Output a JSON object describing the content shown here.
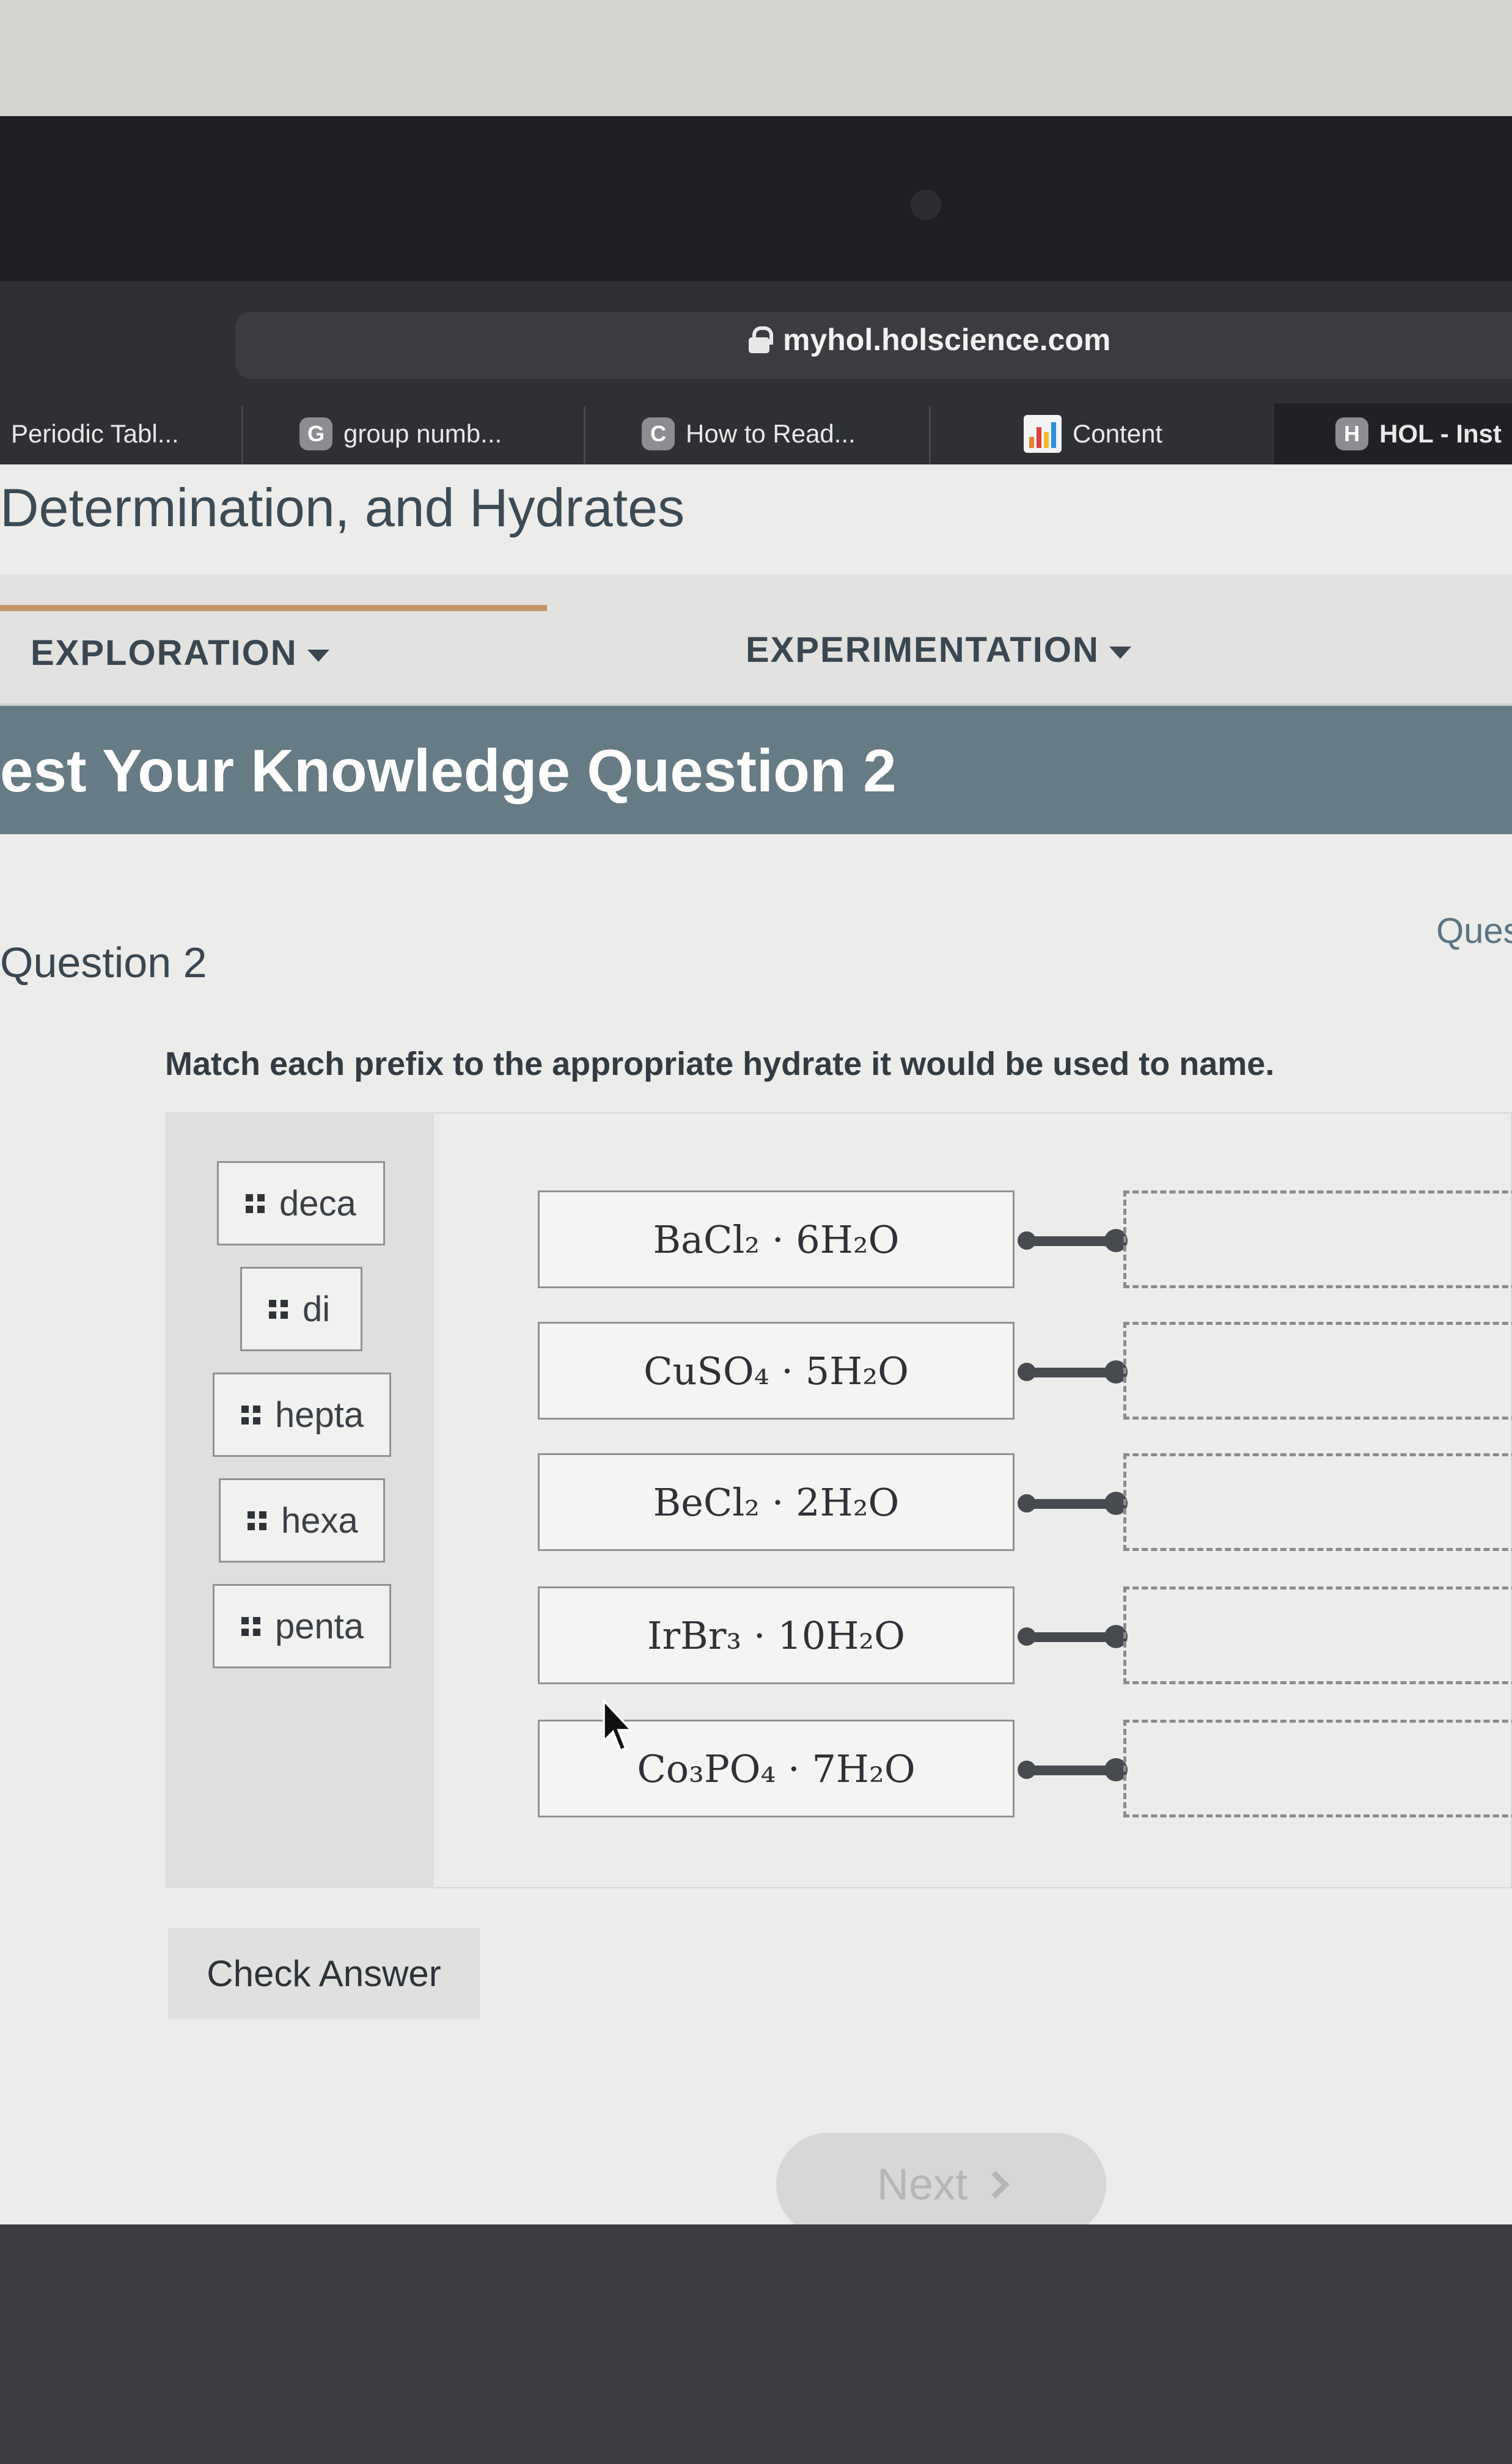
{
  "browser": {
    "url": "myhol.holscience.com",
    "tabs": [
      {
        "label": "Periodic Tabl...",
        "icon": "none"
      },
      {
        "label": "group numb...",
        "icon": "G"
      },
      {
        "label": "How to Read...",
        "icon": "C"
      },
      {
        "label": "Content",
        "icon": "bar-chart-icon"
      },
      {
        "label": "HOL - Inst",
        "icon": "H"
      }
    ]
  },
  "page": {
    "subtitle": "Determination, and Hydrates",
    "nav": {
      "exploration": "EXPLORATION",
      "experimentation": "EXPERIMENTATION"
    },
    "banner_title": "est Your Knowledge Question 2",
    "question_label": "Question 2",
    "question_link": "Ques",
    "prompt": "Match each prefix to the appropriate hydrate it would be used to name."
  },
  "prefixes": [
    "deca",
    "di",
    "hepta",
    "hexa",
    "penta"
  ],
  "hydrates": [
    "BaCl₂ · 6H₂O",
    "CuSO₄ · 5H₂O",
    "BeCl₂ · 2H₂O",
    "IrBr₃ · 10H₂O",
    "Co₃PO₄ · 7H₂O"
  ],
  "buttons": {
    "check": "Check Answer",
    "next": "Next"
  }
}
